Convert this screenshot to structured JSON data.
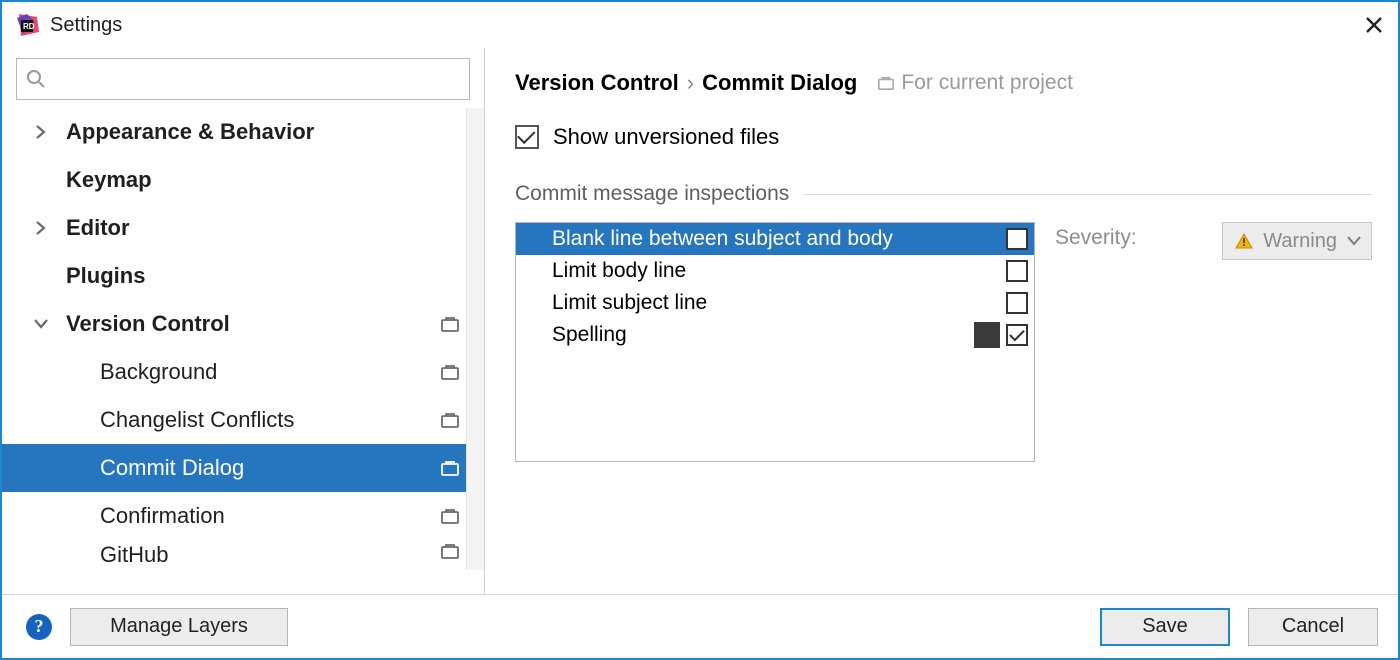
{
  "window": {
    "title": "Settings"
  },
  "search": {
    "placeholder": ""
  },
  "sidebar": {
    "items": [
      {
        "label": "Appearance & Behavior"
      },
      {
        "label": "Keymap"
      },
      {
        "label": "Editor"
      },
      {
        "label": "Plugins"
      },
      {
        "label": "Version Control"
      },
      {
        "label": "Background"
      },
      {
        "label": "Changelist Conflicts"
      },
      {
        "label": "Commit Dialog"
      },
      {
        "label": "Confirmation"
      },
      {
        "label": "GitHub"
      }
    ]
  },
  "main": {
    "crumb1": "Version Control",
    "sep": "›",
    "crumb2": "Commit Dialog",
    "scope": "For current project",
    "show_unversioned": "Show unversioned files",
    "section": "Commit message inspections",
    "inspections": [
      {
        "name": "Blank line between subject and body",
        "checked": false,
        "swatch": false
      },
      {
        "name": "Limit body line",
        "checked": false,
        "swatch": false
      },
      {
        "name": "Limit subject line",
        "checked": false,
        "swatch": false
      },
      {
        "name": "Spelling",
        "checked": true,
        "swatch": true
      }
    ],
    "severity_label": "Severity:",
    "severity_value": "Warning"
  },
  "footer": {
    "manage": "Manage Layers",
    "save": "Save",
    "cancel": "Cancel"
  }
}
